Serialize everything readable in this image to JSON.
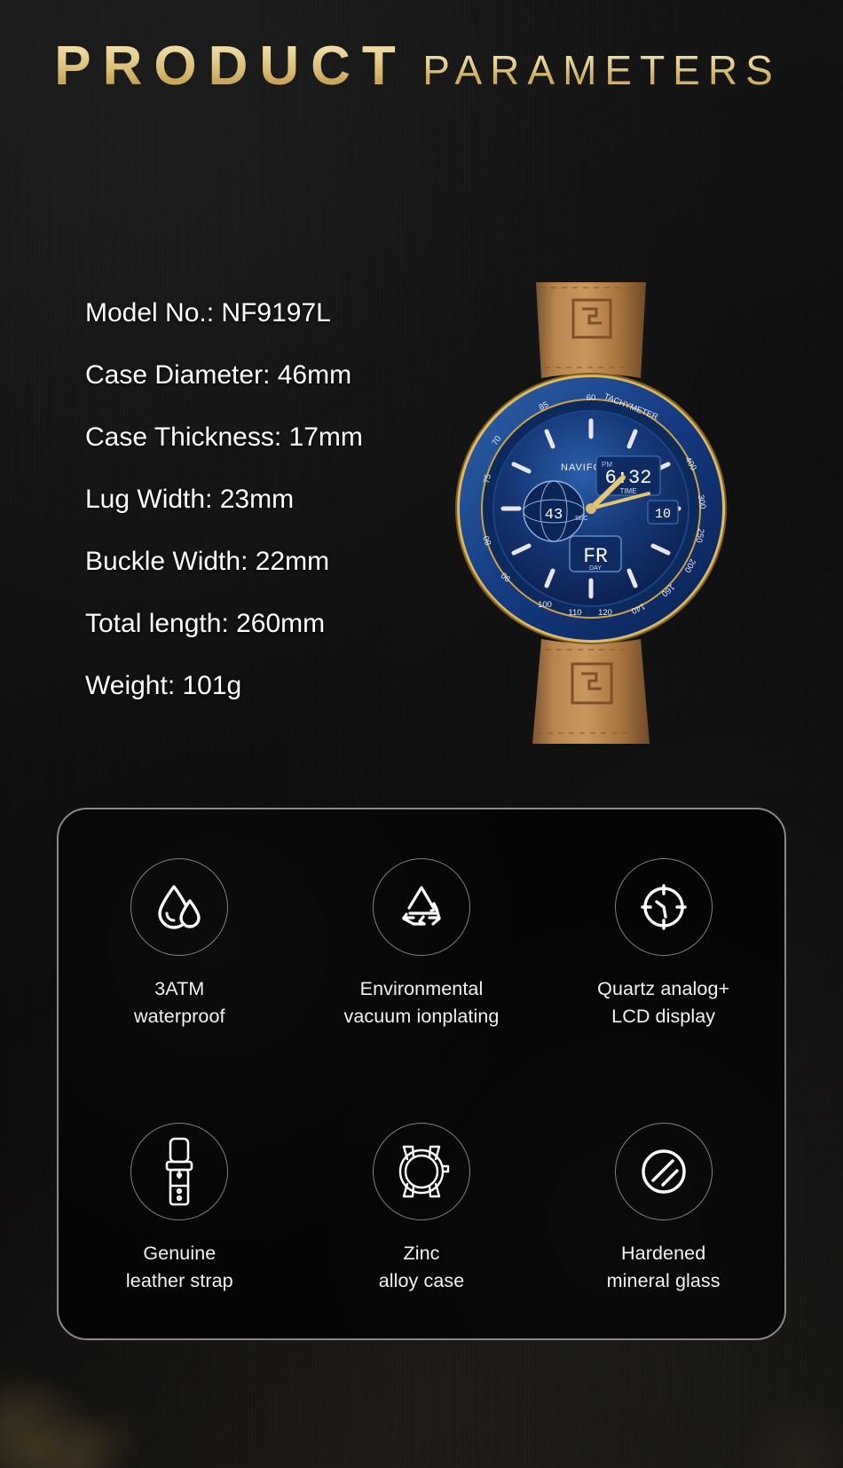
{
  "header": {
    "title_main": "PRODUCT",
    "title_sub": "PARAMETERS",
    "gold_color": "#d8bb73"
  },
  "specs": {
    "items": [
      {
        "label": "Model No.: NF9197L"
      },
      {
        "label": "Case Diameter: 46mm"
      },
      {
        "label": "Case Thickness: 17mm"
      },
      {
        "label": "Lug Width: 23mm"
      },
      {
        "label": "Buckle Width: 22mm"
      },
      {
        "label": "Total length: 260mm"
      },
      {
        "label": "Weight: 101g"
      }
    ],
    "text_color": "#ffffff"
  },
  "product_image": {
    "name": "naviforce-watch",
    "brand_text": "NAVIFORCE",
    "bezel_text": "TACHYMETER",
    "dial_sub_time": "TIME",
    "dial_sub_sec": "SEC",
    "dial_sub_day": "DAY",
    "digital_time": "6:32",
    "digital_pm": "PM",
    "digital_sec": "43",
    "digital_day": "FR",
    "digital_right": "10",
    "case_color": "#c9a24a",
    "dial_color": "#12326b",
    "strap_color": "#b07f4e"
  },
  "features": {
    "items": [
      {
        "icon": "water-drop-icon",
        "caption": "3ATM\nwaterproof"
      },
      {
        "icon": "recycle-icon",
        "caption": "Environmental\nvacuum ionplating"
      },
      {
        "icon": "clock-icon",
        "caption": "Quartz analog+\nLCD display"
      },
      {
        "icon": "leather-strap-icon",
        "caption": "Genuine\nleather strap"
      },
      {
        "icon": "watch-case-icon",
        "caption": "Zinc\nalloy case"
      },
      {
        "icon": "mineral-glass-icon",
        "caption": "Hardened\nmineral glass"
      }
    ],
    "border_color": "#8a8a8a",
    "icon_color": "#ffffff"
  }
}
